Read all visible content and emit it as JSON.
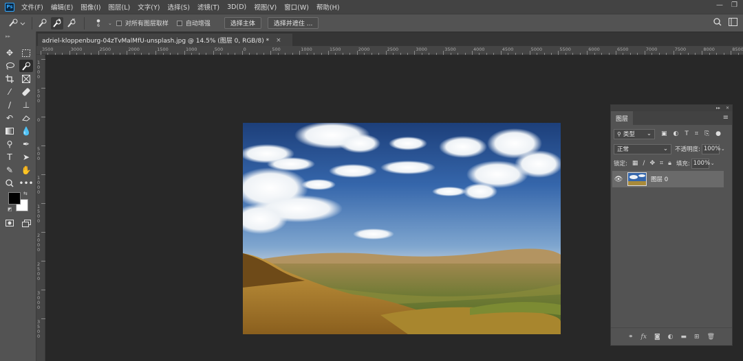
{
  "menubar": {
    "logo": "Ps",
    "items": [
      "文件(F)",
      "编辑(E)",
      "图像(I)",
      "图层(L)",
      "文字(Y)",
      "选择(S)",
      "滤镜(T)",
      "3D(D)",
      "视图(V)",
      "窗口(W)",
      "帮助(H)"
    ],
    "minimize": "—",
    "restore": "❐"
  },
  "options": {
    "brush_size": "6",
    "sample_all_layers": "对所有图层取样",
    "auto_enhance": "自动增强",
    "select_subject": "选择主体",
    "select_mask": "选择并遮住 ..."
  },
  "document": {
    "tab_title": "adriel-kloppenburg-04zTvMalMfU-unsplash.jpg @ 14.5% (图层 0, RGB/8) *",
    "close": "×"
  },
  "ruler": {
    "top_labels": [
      "3500",
      "3000",
      "2500",
      "2000",
      "1500",
      "1000",
      "500",
      "0",
      "500",
      "1000",
      "1500",
      "2000",
      "2500",
      "3000",
      "3500",
      "4000",
      "4500",
      "5000",
      "5500",
      "6000",
      "6500",
      "7000",
      "7500",
      "8000",
      "8500"
    ],
    "left_labels": [
      "1000",
      "500",
      "0",
      "500",
      "1000",
      "1500",
      "2000",
      "2500",
      "3000",
      "3500"
    ]
  },
  "layers_panel": {
    "tab": "图层",
    "filter_label": "类型",
    "blend_mode": "正常",
    "opacity_label": "不透明度:",
    "opacity_value": "100%",
    "lock_label": "锁定:",
    "fill_label": "填充:",
    "fill_value": "100%",
    "layers": [
      {
        "name": "图层 0",
        "visible": true,
        "selected": true
      }
    ],
    "footer_icons": [
      "link-icon",
      "fx-icon",
      "mask-icon",
      "adjustment-icon",
      "folder-icon",
      "new-layer-icon",
      "trash-icon"
    ],
    "fx_label": "fx"
  },
  "colors": {
    "foreground": "#000000",
    "background": "#ffffff",
    "ui_dark": "#282828",
    "panel": "#535353"
  }
}
